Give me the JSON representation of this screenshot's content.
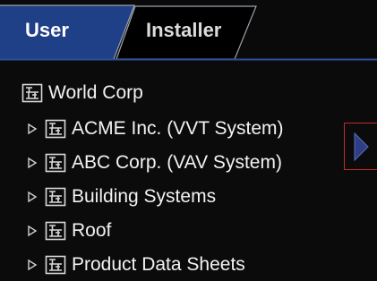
{
  "tabs": [
    {
      "label": "User",
      "active": true
    },
    {
      "label": "Installer",
      "active": false
    }
  ],
  "tree": {
    "root": {
      "label": "World Corp",
      "icon": "building-tree-icon"
    },
    "children": [
      {
        "label": "ACME Inc. (VVT System)",
        "icon": "building-tree-icon",
        "expander": "expand-arrow-icon"
      },
      {
        "label": "ABC Corp. (VAV System)",
        "icon": "building-tree-icon",
        "expander": "expand-arrow-icon"
      },
      {
        "label": "Building Systems",
        "icon": "building-tree-icon",
        "expander": "expand-arrow-icon"
      },
      {
        "label": "Roof",
        "icon": "building-tree-icon",
        "expander": "expand-arrow-icon"
      },
      {
        "label": "Product Data Sheets",
        "icon": "building-tree-icon",
        "expander": "expand-arrow-icon"
      }
    ]
  },
  "side_button": {
    "icon": "chevron-right-icon"
  },
  "colors": {
    "active_tab": "#1f3f86",
    "inactive_tab": "#000000",
    "tab_border": "#9aa2ad",
    "tab_underline": "#2c4f9a",
    "highlight_border": "#c0282d",
    "arrow_fill": "#2d3e86",
    "text": "#f2f2f2"
  }
}
